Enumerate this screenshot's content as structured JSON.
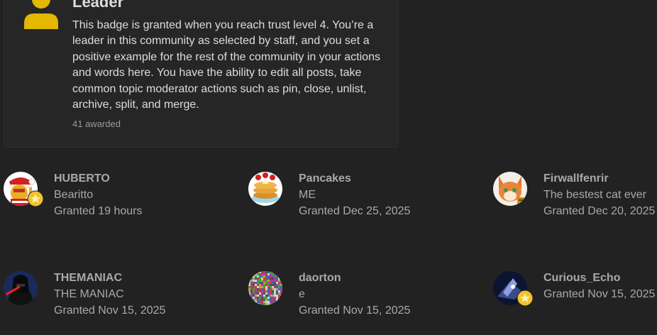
{
  "badge": {
    "icon": "user-icon",
    "icon_color": "#e4b800",
    "title": "Leader",
    "description": "This badge is granted when you reach trust level 4. You’re a leader in this community as selected by staff, and you set a positive example for the rest of the community in your actions and words here. You have the ability to edit all posts, take common topic moderator actions such as pin, close, unlist, archive, split, and merge.",
    "awarded": "41 awarded"
  },
  "users": [
    {
      "username": "HUBERTO",
      "title": "Bearitto",
      "granted": "Granted 19 hours",
      "has_star": true
    },
    {
      "username": "Pancakes",
      "title": "ME",
      "granted": "Granted Dec 25, 2025",
      "has_star": false
    },
    {
      "username": "Firwallfenrir",
      "title": "The bestest cat ever",
      "granted": "Granted Dec 20, 2025",
      "has_star": false
    },
    {
      "username": "THEMANIAC",
      "title": "THE MANIAC",
      "granted": "Granted Nov 15, 2025",
      "has_star": false
    },
    {
      "username": "daorton",
      "title": "e",
      "granted": "Granted Nov 15, 2025",
      "has_star": false
    },
    {
      "username": "Curious_Echo",
      "title": "",
      "granted": "Granted Nov 15, 2025",
      "has_star": true
    }
  ],
  "colors": {
    "background": "#222222",
    "card": "#262626",
    "star": "#f2c12e"
  }
}
